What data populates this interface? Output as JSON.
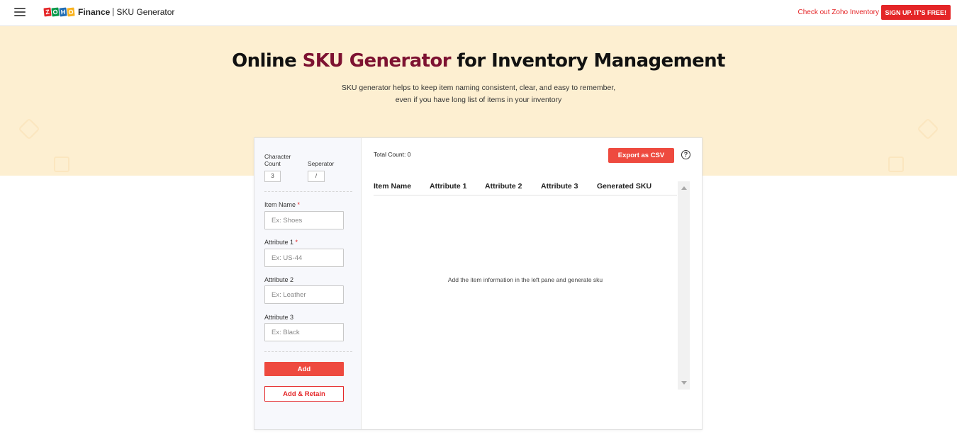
{
  "header": {
    "logo_letters": [
      "Z",
      "O",
      "H",
      "O"
    ],
    "logo_colors": [
      "#e42527",
      "#089949",
      "#226db4",
      "#f9b21d"
    ],
    "brand": "Finance",
    "product": "SKU Generator",
    "check_link": "Check out Zoho Inventory",
    "signup_label": "SIGN UP. IT'S FREE!"
  },
  "hero": {
    "title_prefix": "Online ",
    "title_accent": "SKU Generator",
    "title_suffix": " for Inventory Management",
    "subtitle_line1": "SKU generator helps to keep item naming consistent, clear, and easy to remember,",
    "subtitle_line2": "even if you have long list of items in your inventory"
  },
  "settings": {
    "char_count_label": "Character Count",
    "char_count_value": "3",
    "separator_label": "Seperator",
    "separator_value": "/"
  },
  "form": {
    "item_name": {
      "label": "Item Name",
      "required": "*",
      "placeholder": "Ex: Shoes"
    },
    "attr1": {
      "label": "Attribute 1",
      "required": "*",
      "placeholder": "Ex: US-44"
    },
    "attr2": {
      "label": "Attribute 2",
      "placeholder": "Ex: Leather"
    },
    "attr3": {
      "label": "Attribute 3",
      "placeholder": "Ex: Black"
    },
    "add_label": "Add",
    "add_retain_label": "Add & Retain"
  },
  "results": {
    "total_count": "Total Count: 0",
    "export_label": "Export as CSV",
    "help_symbol": "?",
    "columns": [
      "Item Name",
      "Attribute 1",
      "Attribute 2",
      "Attribute 3",
      "Generated SKU"
    ],
    "empty_message": "Add the item information in the left pane and generate sku"
  },
  "colors": {
    "accent_red": "#e42527",
    "button_red": "#ee4a3f",
    "hero_bg": "#fdefd1",
    "title_accent": "#7d1231"
  }
}
